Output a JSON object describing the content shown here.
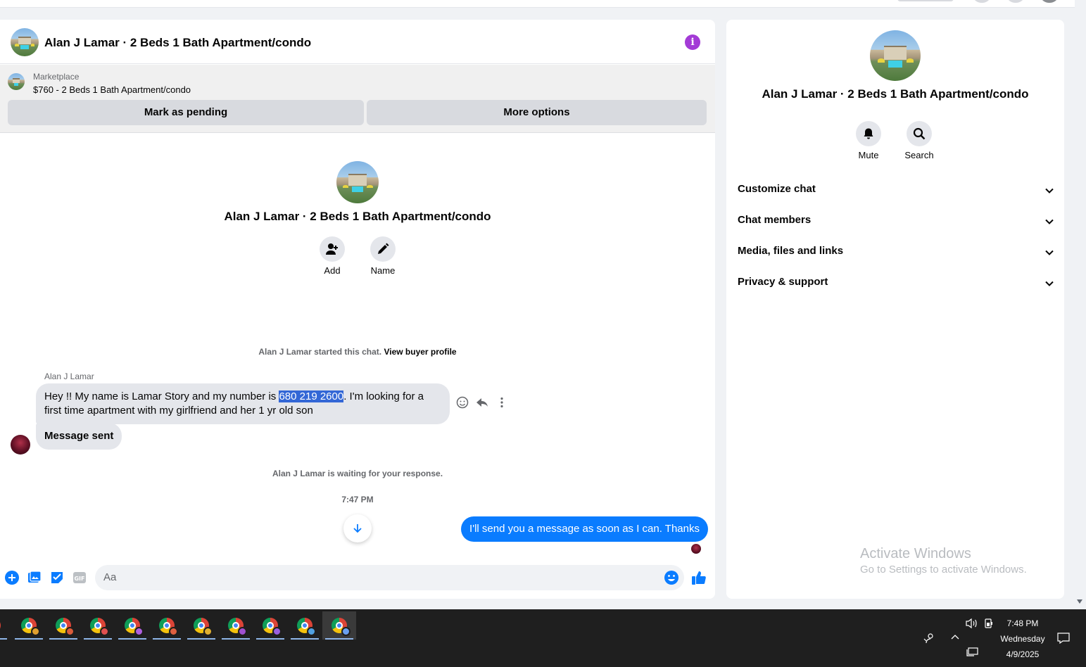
{
  "chat": {
    "title": "Alan J Lamar · 2 Beds 1 Bath Apartment/condo",
    "marketplace_label": "Marketplace",
    "listing": "$760 - 2 Beds 1 Bath Apartment/condo",
    "mark_pending_label": "Mark as pending",
    "more_options_label": "More options",
    "intro_title": "Alan J Lamar · 2 Beds 1 Bath Apartment/condo",
    "add_label": "Add",
    "name_label": "Name",
    "started_text": "Alan J Lamar started this chat.",
    "view_profile_label": "View buyer profile",
    "sender_name": "Alan J Lamar",
    "message1_before": "Hey !! My name is Lamar Story and my number is ",
    "message1_highlight": "680 219 2600",
    "message1_after": ". I'm looking for a first time apartment with my girlfriend and her 1 yr old son",
    "message2": "Message sent",
    "waiting_text": "Alan J Lamar is waiting for your response.",
    "timestamp": "7:47 PM",
    "outgoing_message": "I'll send you a message as soon as I can. Thanks",
    "composer_placeholder": "Aa"
  },
  "side": {
    "title": "Alan J Lamar · 2 Beds 1 Bath Apartment/condo",
    "mute_label": "Mute",
    "search_label": "Search",
    "sections": [
      "Customize chat",
      "Chat members",
      "Media, files and links",
      "Privacy & support"
    ]
  },
  "watermark": {
    "line1": "Activate Windows",
    "line2": "Go to Settings to activate Windows."
  },
  "taskbar": {
    "time": "7:48 PM",
    "day": "Wednesday",
    "date": "4/9/2025",
    "apps": [
      {
        "name": "chrome-profile",
        "badge_color": "#e0a030"
      },
      {
        "name": "chrome-profile",
        "badge_color": "#d95c3a"
      },
      {
        "name": "chrome-profile",
        "badge_color": "#e05050"
      },
      {
        "name": "chrome-profile",
        "badge_color": "#b060e0"
      },
      {
        "name": "chrome-profile",
        "badge_color": "#e06040"
      },
      {
        "name": "chrome-profile",
        "badge_color": "#e0b030"
      },
      {
        "name": "chrome-profile",
        "badge_color": "#a050d0"
      },
      {
        "name": "chrome-profile",
        "badge_color": "#9a60e0"
      },
      {
        "name": "chrome-profile",
        "badge_color": "#50a0e0"
      },
      {
        "name": "chrome-profile",
        "badge_color": "#6aa0f0"
      }
    ]
  },
  "colors": {
    "accent": "#0a7cff",
    "info": "#a33bd6",
    "selection": "#3367d6"
  }
}
